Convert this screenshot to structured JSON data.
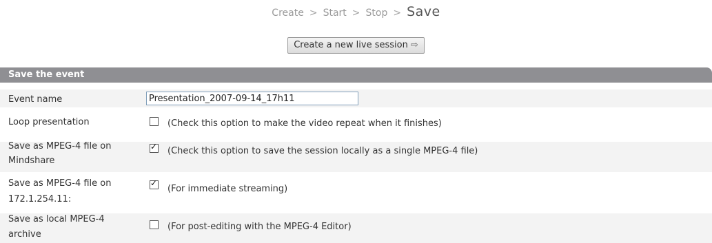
{
  "breadcrumb": {
    "steps": [
      "Create",
      "Start",
      "Stop"
    ],
    "separator": ">",
    "current": "Save"
  },
  "new_session_button": {
    "label": "Create a new live session",
    "icon": "arrow-right-icon"
  },
  "form": {
    "title": "Save the event",
    "event_name": {
      "label": "Event name",
      "value": "Presentation_2007-09-14_17h11"
    },
    "loop": {
      "label": "Loop presentation",
      "checked": false,
      "hint": "(Check this option to make the video repeat when it finishes)"
    },
    "mindshare": {
      "label_line1": "Save as MPEG-4 file on",
      "label_line2": "Mindshare",
      "checked": true,
      "hint": "(Check this option to save the session locally as a single MPEG-4 file)"
    },
    "server": {
      "label_line1": "Save as MPEG-4 file on",
      "label_line2": "172.1.254.11:",
      "checked": true,
      "hint": "(For immediate streaming)"
    },
    "local_archive": {
      "label_line1": "Save as local MPEG-4",
      "label_line2": "archive",
      "checked": false,
      "hint": "(For post-editing with the MPEG-4 Editor)"
    }
  },
  "colors": {
    "header_bg": "#8f8f93",
    "band_bg": "#f3f3f3"
  }
}
